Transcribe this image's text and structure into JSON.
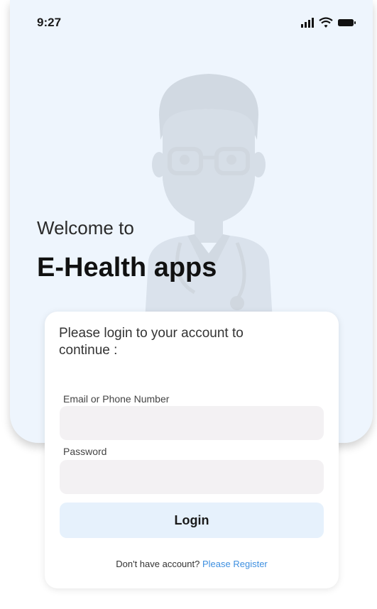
{
  "status_bar": {
    "time": "9:27",
    "icons": [
      "signal-icon",
      "wifi-icon",
      "battery-icon"
    ]
  },
  "hero": {
    "welcome_text": "Welcome to",
    "app_title": "E-Health apps",
    "illustration": "doctor-illustration"
  },
  "login_card": {
    "intro": "Please login to your account to continue :",
    "email_label": "Email or Phone Number",
    "email_value": "",
    "password_label": "Password",
    "password_value": "",
    "login_button": "Login",
    "register_prompt": "Don't have account?",
    "register_link": "Please Register"
  },
  "colors": {
    "hero_background": "#eef5fd",
    "input_background": "#f3f1f3",
    "button_background": "#e6f1fc",
    "link_color": "#3d8fe0"
  }
}
